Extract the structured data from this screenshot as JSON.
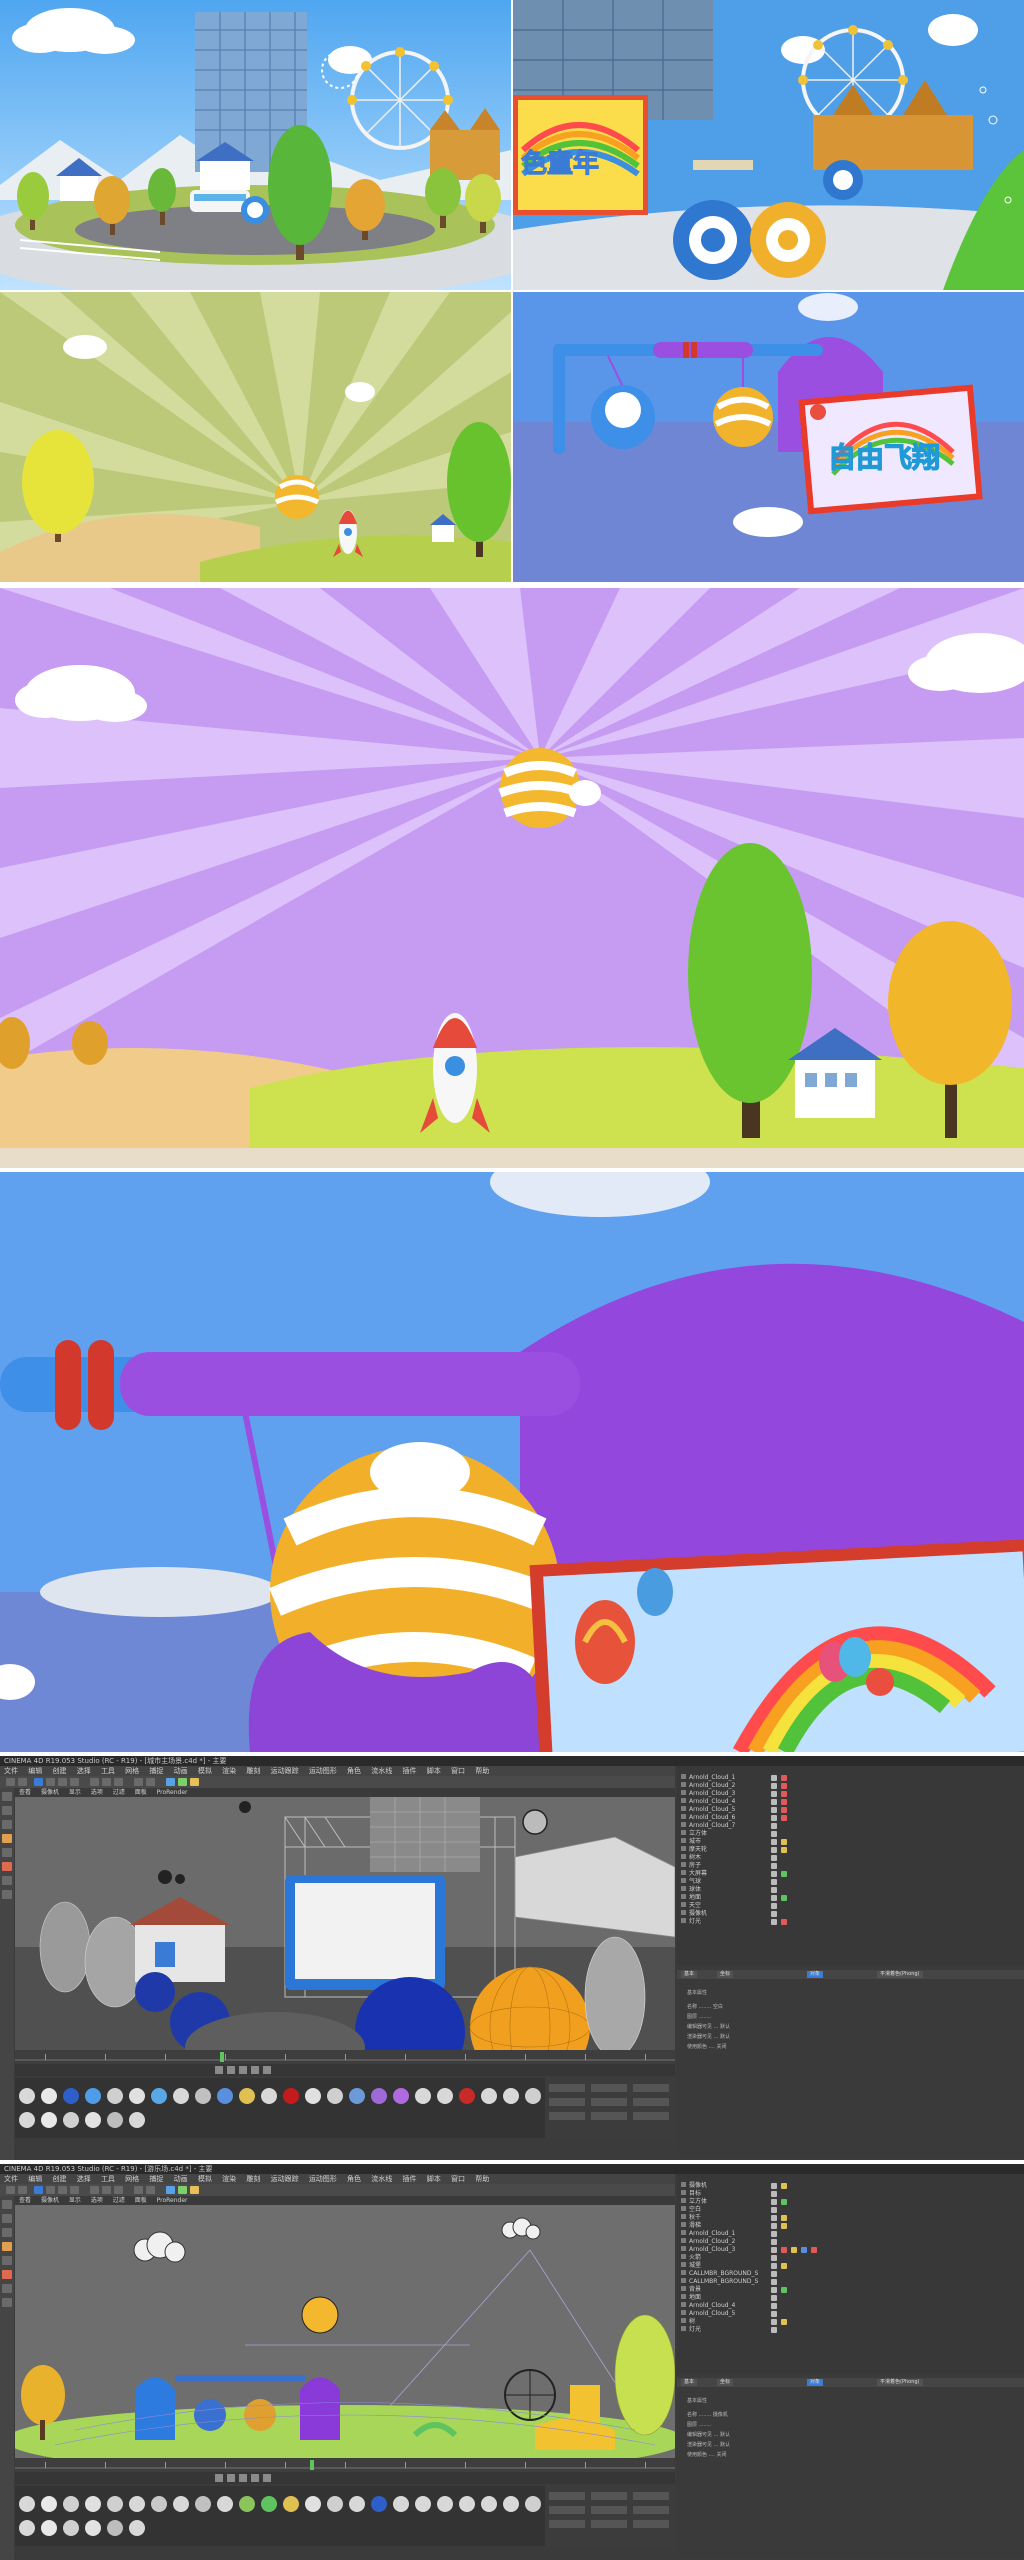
{
  "signs": {
    "childhood_partial": "色童年",
    "free_flight": "自由飞翔"
  },
  "c4d_ui": {
    "window_title_1": "CINEMA 4D R19.053 Studio (RC - R19) - [城市主场景.c4d *] - 主要",
    "window_title_2": "CINEMA 4D R19.053 Studio (RC - R19) - [游乐场.c4d *] - 主要",
    "menu_items": [
      "文件",
      "编辑",
      "创建",
      "选择",
      "工具",
      "网格",
      "捕捉",
      "动画",
      "模拟",
      "渲染",
      "雕刻",
      "运动跟踪",
      "运动图形",
      "角色",
      "流水线",
      "插件",
      "脚本",
      "窗口",
      "帮助"
    ],
    "viewport_menu": [
      "查看",
      "摄像机",
      "显示",
      "选项",
      "过滤",
      "面板",
      "ProRender"
    ],
    "object_rows_1": [
      "Arnold_Cloud_1",
      "Arnold_Cloud_2",
      "Arnold_Cloud_3",
      "Arnold_Cloud_4",
      "Arnold_Cloud_5",
      "Arnold_Cloud_6",
      "Arnold_Cloud_7",
      "立方体",
      "城市",
      "摩天轮",
      "树木",
      "房子",
      "大屏幕",
      "气球",
      "球体",
      "地面",
      "天空",
      "摄像机",
      "灯光"
    ],
    "object_rows_2": [
      "摄像机",
      "目标",
      "立方体",
      "空白",
      "秋千",
      "滑梯",
      "Arnold_Cloud_1",
      "Arnold_Cloud_2",
      "Arnold_Cloud_3",
      "火箭",
      "城堡",
      "CALLMBR_BGROUND_S",
      "CALLMBR_BGROUND_S",
      "背景",
      "地面",
      "Arnold_Cloud_4",
      "Arnold_Cloud_5",
      "树",
      "灯光"
    ],
    "attr_tabs": [
      "基本",
      "坐标",
      "对象",
      "平滑着色(Phong)"
    ],
    "attr_lines_1": [
      "基本属性",
      "名称 ........ 空白",
      "图层 ........",
      "编辑器可见 ... 默认",
      "渲染器可见 ... 默认",
      "使用颜色 .... 关闭"
    ],
    "attr_lines_2": [
      "基本属性",
      "名称 ........ 摄像机",
      "图层 ........",
      "编辑器可见 ... 默认",
      "渲染器可见 ... 默认",
      "使用颜色 .... 关闭"
    ],
    "colors": {
      "panel_bg": "#3b3b3b",
      "viewport_bg": "#6e6e6e",
      "accent_blue": "#3a7bd5"
    }
  }
}
